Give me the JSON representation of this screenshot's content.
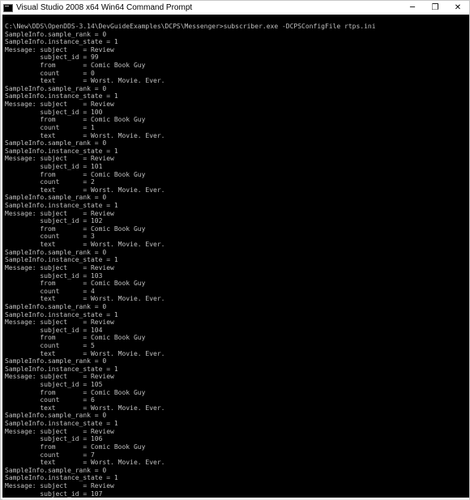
{
  "window": {
    "title": "Visual Studio 2008 x64 Win64 Command Prompt",
    "icon": "console-app-icon",
    "controls": {
      "minimize": "─",
      "maximize": "❐",
      "close": "✕"
    }
  },
  "console": {
    "lines": [
      "C:\\New\\DDS\\OpenDDS-3.14\\DevGuideExamples\\DCPS\\Messenger>subscriber.exe -DCPSConfigFile rtps.ini",
      "SampleInfo.sample_rank = 0",
      "SampleInfo.instance_state = 1",
      "Message: subject    = Review",
      "         subject_id = 99",
      "         from       = Comic Book Guy",
      "         count      = 0",
      "         text       = Worst. Movie. Ever.",
      "SampleInfo.sample_rank = 0",
      "SampleInfo.instance_state = 1",
      "Message: subject    = Review",
      "         subject_id = 100",
      "         from       = Comic Book Guy",
      "         count      = 1",
      "         text       = Worst. Movie. Ever.",
      "SampleInfo.sample_rank = 0",
      "SampleInfo.instance_state = 1",
      "Message: subject    = Review",
      "         subject_id = 101",
      "         from       = Comic Book Guy",
      "         count      = 2",
      "         text       = Worst. Movie. Ever.",
      "SampleInfo.sample_rank = 0",
      "SampleInfo.instance_state = 1",
      "Message: subject    = Review",
      "         subject_id = 102",
      "         from       = Comic Book Guy",
      "         count      = 3",
      "         text       = Worst. Movie. Ever.",
      "SampleInfo.sample_rank = 0",
      "SampleInfo.instance_state = 1",
      "Message: subject    = Review",
      "         subject_id = 103",
      "         from       = Comic Book Guy",
      "         count      = 4",
      "         text       = Worst. Movie. Ever.",
      "SampleInfo.sample_rank = 0",
      "SampleInfo.instance_state = 1",
      "Message: subject    = Review",
      "         subject_id = 104",
      "         from       = Comic Book Guy",
      "         count      = 5",
      "         text       = Worst. Movie. Ever.",
      "SampleInfo.sample_rank = 0",
      "SampleInfo.instance_state = 1",
      "Message: subject    = Review",
      "         subject_id = 105",
      "         from       = Comic Book Guy",
      "         count      = 6",
      "         text       = Worst. Movie. Ever.",
      "SampleInfo.sample_rank = 0",
      "SampleInfo.instance_state = 1",
      "Message: subject    = Review",
      "         subject_id = 106",
      "         from       = Comic Book Guy",
      "         count      = 7",
      "         text       = Worst. Movie. Ever.",
      "SampleInfo.sample_rank = 0",
      "SampleInfo.instance_state = 1",
      "Message: subject    = Review",
      "         subject_id = 107"
    ]
  },
  "colors": {
    "console_bg": "#000000",
    "console_fg": "#c0c0c0",
    "titlebar_bg": "#ffffff"
  }
}
